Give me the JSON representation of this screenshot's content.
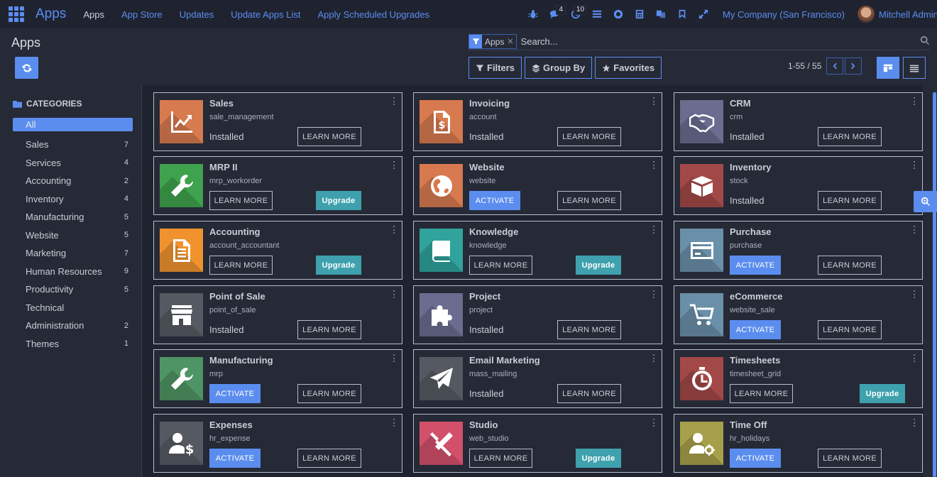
{
  "navbar": {
    "brand": "Apps",
    "menu": [
      "Apps",
      "App Store",
      "Updates",
      "Update Apps List",
      "Apply Scheduled Upgrades"
    ],
    "systray": [
      {
        "icon": "bug-icon",
        "badge": ""
      },
      {
        "icon": "chat-icon",
        "badge": "4"
      },
      {
        "icon": "clock-icon",
        "badge": "10"
      },
      {
        "icon": "list-icon",
        "badge": ""
      },
      {
        "icon": "lifebuoy-icon",
        "badge": ""
      },
      {
        "icon": "calculator-icon",
        "badge": ""
      },
      {
        "icon": "translate-icon",
        "badge": ""
      },
      {
        "icon": "bookmark-icon",
        "badge": ""
      },
      {
        "icon": "expand-icon",
        "badge": ""
      }
    ],
    "company": "My Company (San Francisco)",
    "user": "Mitchell Admin"
  },
  "control_panel": {
    "title": "Apps",
    "search": {
      "facet": "Apps",
      "placeholder": "Search..."
    },
    "filters": {
      "filters": "Filters",
      "group_by": "Group By",
      "favorites": "Favorites"
    },
    "pager": "1-55 / 55"
  },
  "sidebar": {
    "header": "CATEGORIES",
    "items": [
      {
        "label": "All",
        "count": ""
      },
      {
        "label": "Sales",
        "count": "7"
      },
      {
        "label": "Services",
        "count": "4"
      },
      {
        "label": "Accounting",
        "count": "2"
      },
      {
        "label": "Inventory",
        "count": "4"
      },
      {
        "label": "Manufacturing",
        "count": "5"
      },
      {
        "label": "Website",
        "count": "5"
      },
      {
        "label": "Marketing",
        "count": "7"
      },
      {
        "label": "Human Resources",
        "count": "9"
      },
      {
        "label": "Productivity",
        "count": "5"
      },
      {
        "label": "Technical",
        "count": ""
      },
      {
        "label": "Administration",
        "count": "2"
      },
      {
        "label": "Themes",
        "count": "1"
      }
    ]
  },
  "labels": {
    "installed": "Installed",
    "learn_more": "LEARN MORE",
    "activate": "ACTIVATE",
    "upgrade": "Upgrade"
  },
  "apps": [
    {
      "name": "Sales",
      "tech": "sale_management",
      "state": "installed",
      "icon": "chart-trend-icon",
      "color": "#d87a4f"
    },
    {
      "name": "Invoicing",
      "tech": "account",
      "state": "installed",
      "icon": "invoice-dollar-icon",
      "color": "#d87a4f"
    },
    {
      "name": "CRM",
      "tech": "crm",
      "state": "installed",
      "icon": "handshake-icon",
      "color": "#6b6c8f"
    },
    {
      "name": "MRP II",
      "tech": "mrp_workorder",
      "state": "upgrade",
      "icon": "wrench-icon",
      "color": "#3fa34d"
    },
    {
      "name": "Website",
      "tech": "website",
      "state": "activate",
      "icon": "globe-icon",
      "color": "#d87a4f"
    },
    {
      "name": "Inventory",
      "tech": "stock",
      "state": "installed",
      "icon": "box-icon",
      "color": "#a34848"
    },
    {
      "name": "Accounting",
      "tech": "account_accountant",
      "state": "upgrade",
      "icon": "document-icon",
      "color": "#f0932f"
    },
    {
      "name": "Knowledge",
      "tech": "knowledge",
      "state": "upgrade",
      "icon": "book-icon",
      "color": "#2fa39c"
    },
    {
      "name": "Purchase",
      "tech": "purchase",
      "state": "activate",
      "icon": "credit-card-icon",
      "color": "#6a8fa8"
    },
    {
      "name": "Point of Sale",
      "tech": "point_of_sale",
      "state": "installed",
      "icon": "store-icon",
      "color": "#555a62"
    },
    {
      "name": "Project",
      "tech": "project",
      "state": "installed",
      "icon": "puzzle-icon",
      "color": "#6b6c8f"
    },
    {
      "name": "eCommerce",
      "tech": "website_sale",
      "state": "activate",
      "icon": "cart-icon",
      "color": "#6a8fa8"
    },
    {
      "name": "Manufacturing",
      "tech": "mrp",
      "state": "activate",
      "icon": "wrench-icon",
      "color": "#4f9464"
    },
    {
      "name": "Email Marketing",
      "tech": "mass_mailing",
      "state": "installed",
      "icon": "paper-plane-icon",
      "color": "#555a62"
    },
    {
      "name": "Timesheets",
      "tech": "timesheet_grid",
      "state": "upgrade",
      "icon": "stopwatch-icon",
      "color": "#a34848"
    },
    {
      "name": "Expenses",
      "tech": "hr_expense",
      "state": "activate",
      "icon": "user-dollar-icon",
      "color": "#555a62"
    },
    {
      "name": "Studio",
      "tech": "web_studio",
      "state": "upgrade",
      "icon": "tools-icon",
      "color": "#d2506a"
    },
    {
      "name": "Time Off",
      "tech": "hr_holidays",
      "state": "activate",
      "icon": "user-gear-icon",
      "color": "#a7a04a"
    }
  ]
}
